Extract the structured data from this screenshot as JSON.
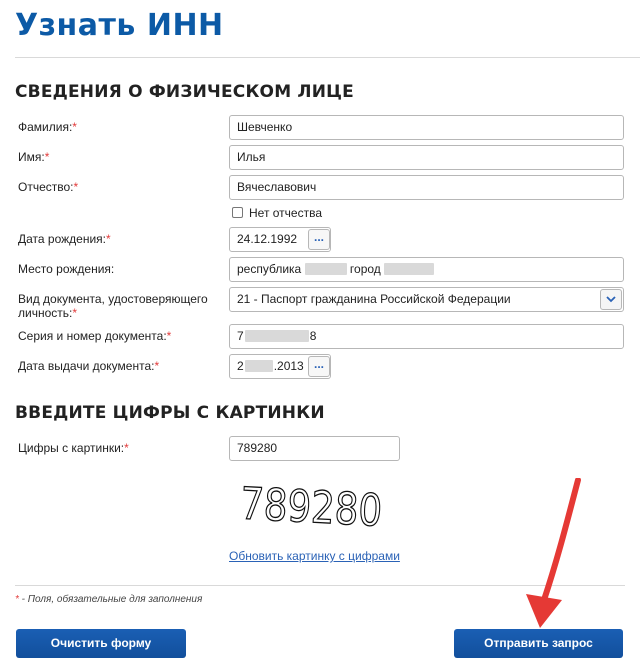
{
  "page_title": "Узнать ИНН",
  "section_person": "СВЕДЕНИЯ О ФИЗИЧЕСКОМ ЛИЦЕ",
  "section_captcha": "ВВЕДИТЕ ЦИФРЫ С КАРТИНКИ",
  "required_mark": "*",
  "fields": {
    "surname": {
      "label": "Фамилия:",
      "value": "Шевченко"
    },
    "name": {
      "label": "Имя:",
      "value": "Илья"
    },
    "patronymic": {
      "label": "Отчество:",
      "value": "Вячеславович"
    },
    "no_patronymic": {
      "label": "Нет отчества",
      "checked": false
    },
    "birth_date": {
      "label": "Дата рождения:",
      "value": "24.12.1992"
    },
    "birth_place": {
      "label": "Место рождения:",
      "value_part1": "республика",
      "value_part2": "город"
    },
    "doc_type": {
      "label_line1": "Вид документа, удостоверяющего",
      "label_line2": "личность:",
      "value": "21 - Паспорт гражданина Российской Федерации"
    },
    "doc_number": {
      "label": "Серия и номер документа:",
      "value_prefix": "7",
      "value_suffix": "8"
    },
    "issue_date": {
      "label": "Дата выдачи документа:",
      "value_prefix": "2",
      "value_suffix": ".2013"
    }
  },
  "captcha": {
    "label": "Цифры с картинки:",
    "value": "789280",
    "image_text": "789280",
    "refresh_link": "Обновить картинку с цифрами"
  },
  "calendar_button_glyph": "...",
  "required_note_mark": "*",
  "required_note": " - Поля, обязательные для заполнения",
  "buttons": {
    "clear": "Очистить форму",
    "submit": "Отправить запрос"
  },
  "colors": {
    "title": "#0c5aa6",
    "button": "#1a5fb4",
    "link": "#2a62b6",
    "required": "#e23a3a",
    "arrow": "#e53935"
  }
}
